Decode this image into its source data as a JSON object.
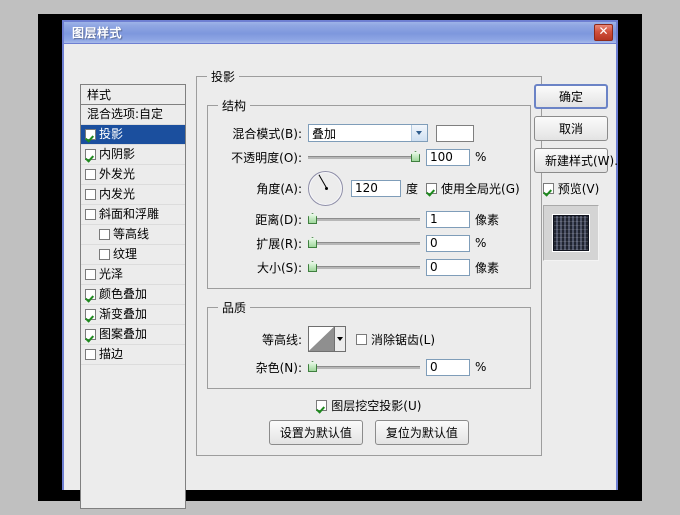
{
  "window": {
    "title": "图层样式",
    "close_label": "✕"
  },
  "styles_panel": {
    "header": "样式",
    "blending_option": "混合选项:自定",
    "items": [
      {
        "label": "投影",
        "checked": true,
        "selected": true,
        "indent": false
      },
      {
        "label": "内阴影",
        "checked": true,
        "selected": false,
        "indent": false
      },
      {
        "label": "外发光",
        "checked": false,
        "selected": false,
        "indent": false
      },
      {
        "label": "内发光",
        "checked": false,
        "selected": false,
        "indent": false
      },
      {
        "label": "斜面和浮雕",
        "checked": false,
        "selected": false,
        "indent": false
      },
      {
        "label": "等高线",
        "checked": false,
        "selected": false,
        "indent": true
      },
      {
        "label": "纹理",
        "checked": false,
        "selected": false,
        "indent": true
      },
      {
        "label": "光泽",
        "checked": false,
        "selected": false,
        "indent": false
      },
      {
        "label": "颜色叠加",
        "checked": true,
        "selected": false,
        "indent": false
      },
      {
        "label": "渐变叠加",
        "checked": true,
        "selected": false,
        "indent": false
      },
      {
        "label": "图案叠加",
        "checked": true,
        "selected": false,
        "indent": false
      },
      {
        "label": "描边",
        "checked": false,
        "selected": false,
        "indent": false
      }
    ]
  },
  "drop_shadow": {
    "group_title": "投影",
    "structure": {
      "title": "结构",
      "blend_mode_label": "混合模式(B):",
      "blend_mode_value": "叠加",
      "color_swatch": "#ffffff",
      "opacity_label": "不透明度(O):",
      "opacity_value": "100",
      "opacity_unit": "%",
      "angle_label": "角度(A):",
      "angle_value": "120",
      "angle_unit": "度",
      "use_global_light": "使用全局光(G)",
      "use_global_light_checked": true,
      "distance_label": "距离(D):",
      "distance_value": "1",
      "distance_unit": "像素",
      "spread_label": "扩展(R):",
      "spread_value": "0",
      "spread_unit": "%",
      "size_label": "大小(S):",
      "size_value": "0",
      "size_unit": "像素"
    },
    "quality": {
      "title": "品质",
      "contour_label": "等高线:",
      "antialias_label": "消除锯齿(L)",
      "antialias_checked": false,
      "noise_label": "杂色(N):",
      "noise_value": "0",
      "noise_unit": "%"
    },
    "knockout_label": "图层挖空投影(U)",
    "knockout_checked": true,
    "set_default_button": "设置为默认值",
    "reset_default_button": "复位为默认值"
  },
  "actions": {
    "ok": "确定",
    "cancel": "取消",
    "new_style": "新建样式(W)...",
    "preview_label": "预览(V)",
    "preview_checked": true
  }
}
